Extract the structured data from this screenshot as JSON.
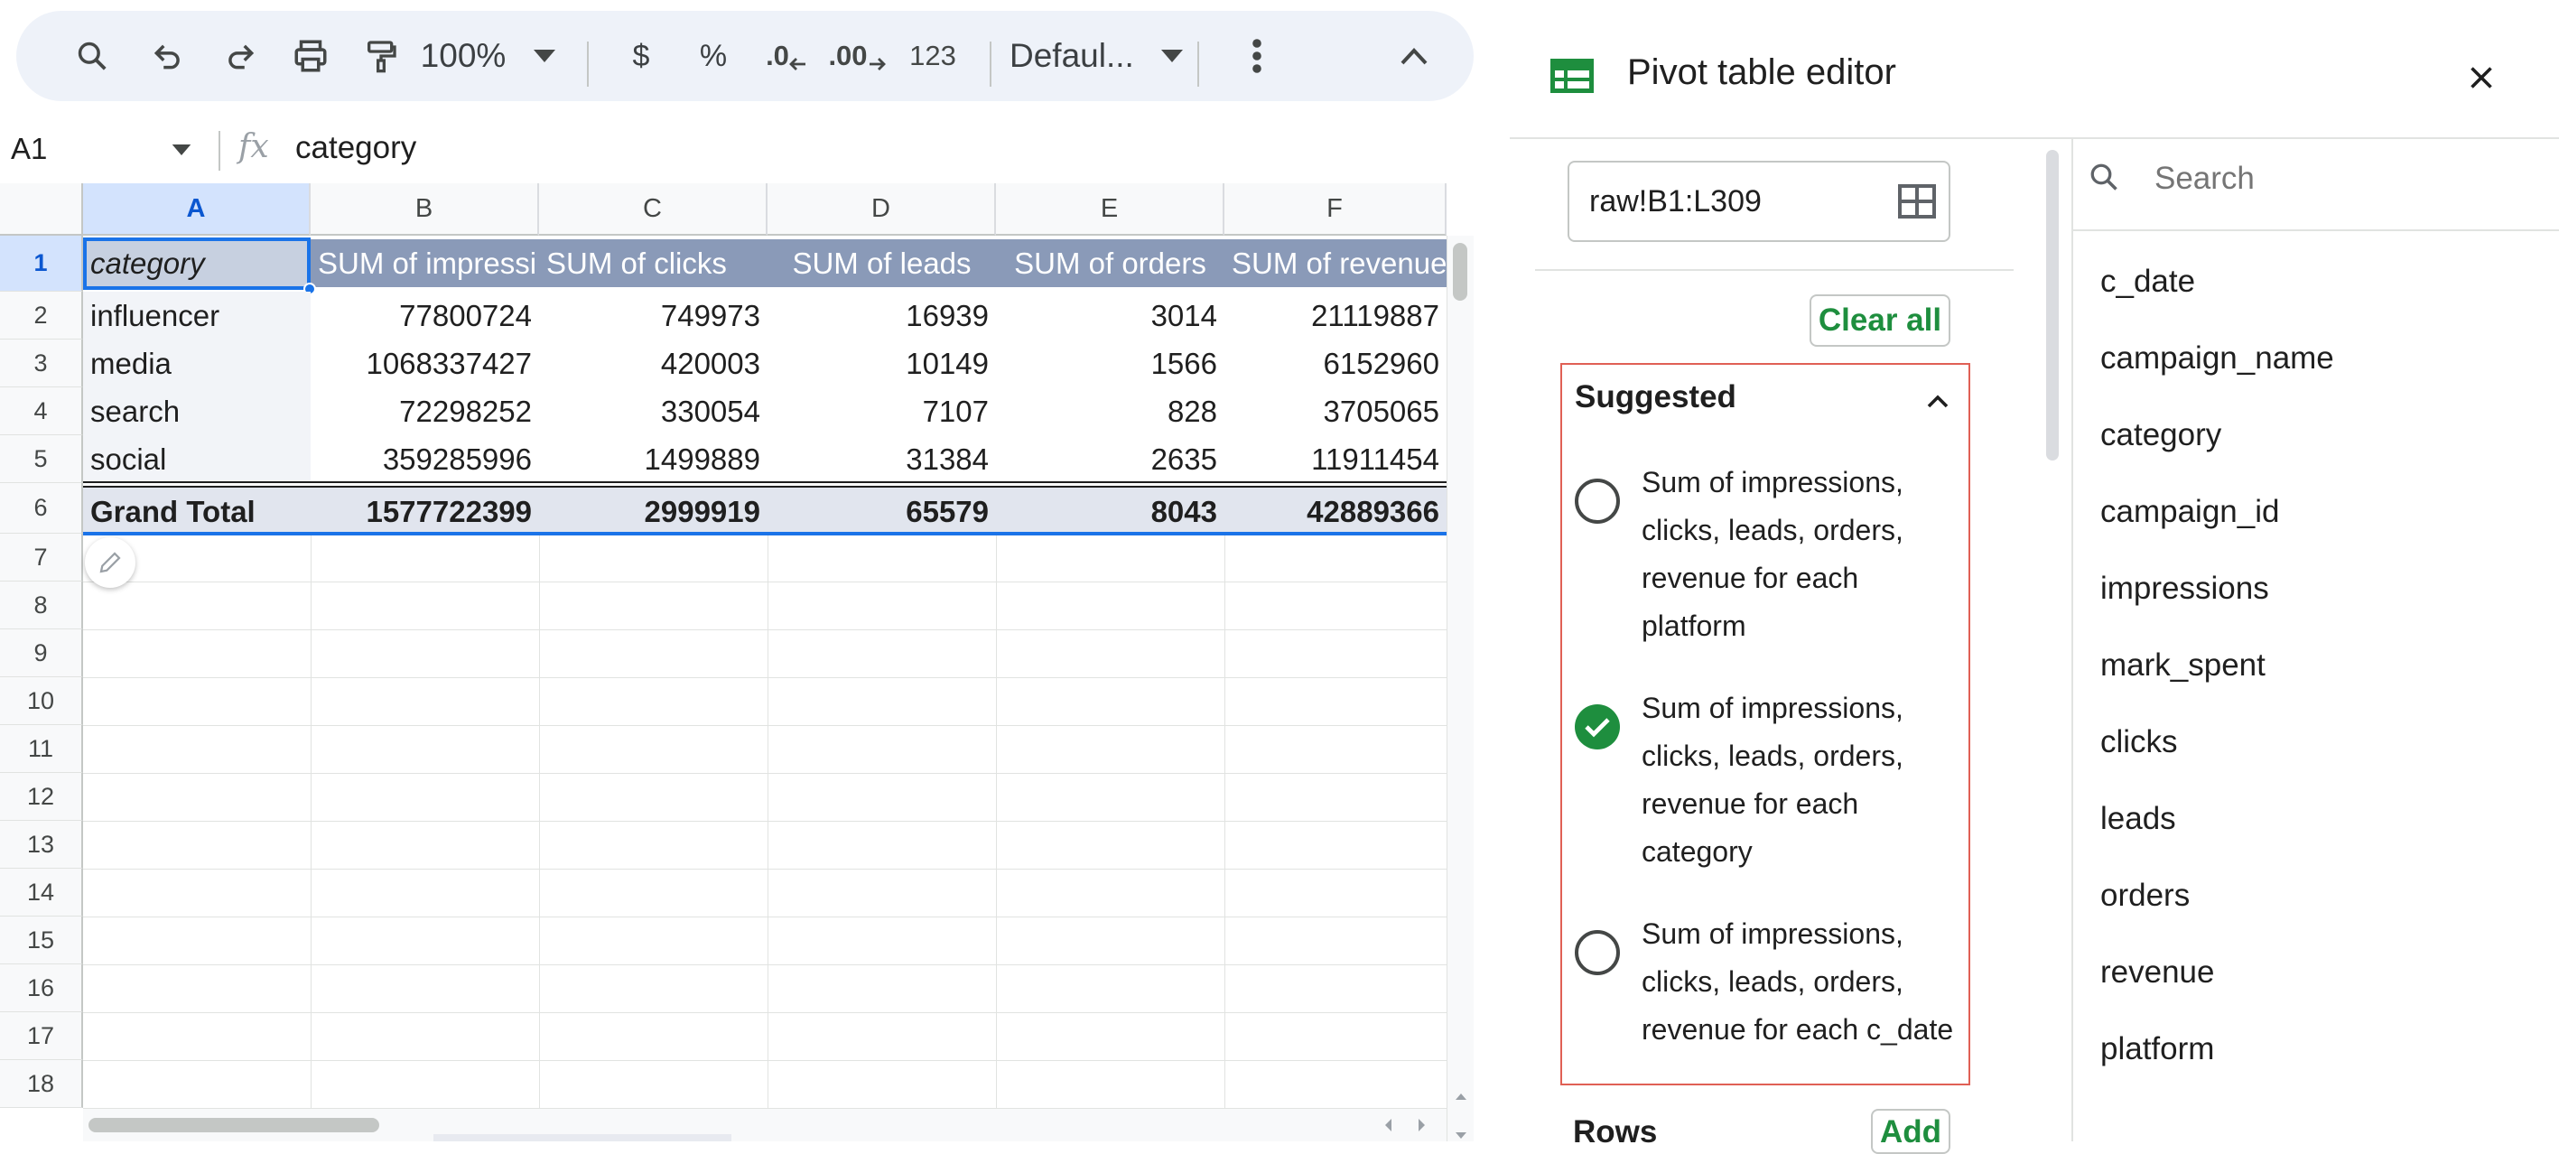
{
  "toolbar": {
    "zoom": "100%",
    "currency": "$",
    "percent": "%",
    "decrease_decimal": ".0",
    "increase_decimal": ".00",
    "number_format": "123",
    "font": "Defaul..."
  },
  "formula_bar": {
    "cell_ref": "A1",
    "fx": "fx",
    "value": "category"
  },
  "grid": {
    "columns": [
      "A",
      "B",
      "C",
      "D",
      "E",
      "F"
    ],
    "rows": [
      "1",
      "2",
      "3",
      "4",
      "5",
      "6",
      "7",
      "8",
      "9",
      "10",
      "11",
      "12",
      "13",
      "14",
      "15",
      "16",
      "17",
      "18"
    ],
    "header": [
      "category",
      "SUM of impressi",
      "SUM of clicks",
      "SUM of leads",
      "SUM of orders",
      "SUM of revenue"
    ],
    "data": [
      [
        "influencer",
        "77800724",
        "749973",
        "16939",
        "3014",
        "21119887"
      ],
      [
        "media",
        "1068337427",
        "420003",
        "10149",
        "1566",
        "6152960"
      ],
      [
        "search",
        "72298252",
        "330054",
        "7107",
        "828",
        "3705065"
      ],
      [
        "social",
        "359285996",
        "1499889",
        "31384",
        "2635",
        "11911454"
      ]
    ],
    "grand_total": [
      "Grand Total",
      "1577722399",
      "2999919",
      "65579",
      "8043",
      "42889366"
    ]
  },
  "panel": {
    "title": "Pivot table editor",
    "range": "raw!B1:L309",
    "clear_all": "Clear all",
    "suggested_title": "Suggested",
    "suggestions": [
      {
        "lines": [
          "Sum of impressions,",
          "clicks, leads, orders,",
          "revenue for each",
          "platform"
        ],
        "checked": false
      },
      {
        "lines": [
          "Sum of impressions,",
          "clicks, leads, orders,",
          "revenue for each",
          "category"
        ],
        "checked": true
      },
      {
        "lines": [
          "Sum of impressions,",
          "clicks, leads, orders,",
          "revenue for each c_date"
        ],
        "checked": false
      }
    ],
    "rows_label": "Rows",
    "add_label": "Add",
    "search_placeholder": "Search",
    "fields": [
      "c_date",
      "campaign_name",
      "category",
      "campaign_id",
      "impressions",
      "mark_spent",
      "clicks",
      "leads",
      "orders",
      "revenue",
      "platform"
    ]
  },
  "colors": {
    "accent_green": "#1e8e3e",
    "pivot_header": "#8a9ab8",
    "selection_blue": "#1a73e8",
    "suggested_border": "#d93025"
  }
}
